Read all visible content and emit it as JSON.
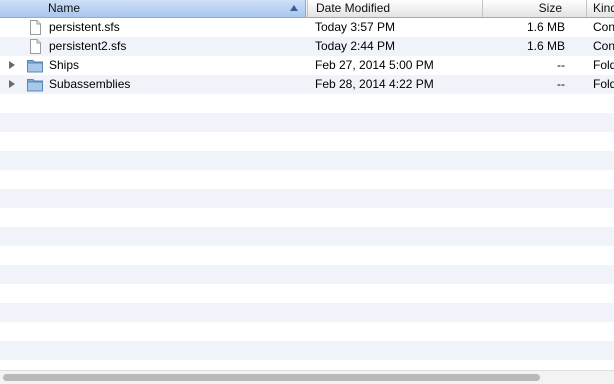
{
  "columns": {
    "name": "Name",
    "date": "Date Modified",
    "size": "Size",
    "kind": "Kind"
  },
  "accent": "#a9c6ee",
  "rows": [
    {
      "name": "persistent.sfs",
      "date": "Today 3:57 PM",
      "size": "1.6 MB",
      "kind": "Con",
      "icon": "document-icon",
      "expandable": false
    },
    {
      "name": "persistent2.sfs",
      "date": "Today 2:44 PM",
      "size": "1.6 MB",
      "kind": "Con",
      "icon": "document-icon",
      "expandable": false
    },
    {
      "name": "Ships",
      "date": "Feb 27, 2014 5:00 PM",
      "size": "--",
      "kind": "Fold",
      "icon": "folder-icon",
      "expandable": true
    },
    {
      "name": "Subassemblies",
      "date": "Feb 28, 2014 4:22 PM",
      "size": "--",
      "kind": "Fold",
      "icon": "folder-icon",
      "expandable": true
    }
  ]
}
